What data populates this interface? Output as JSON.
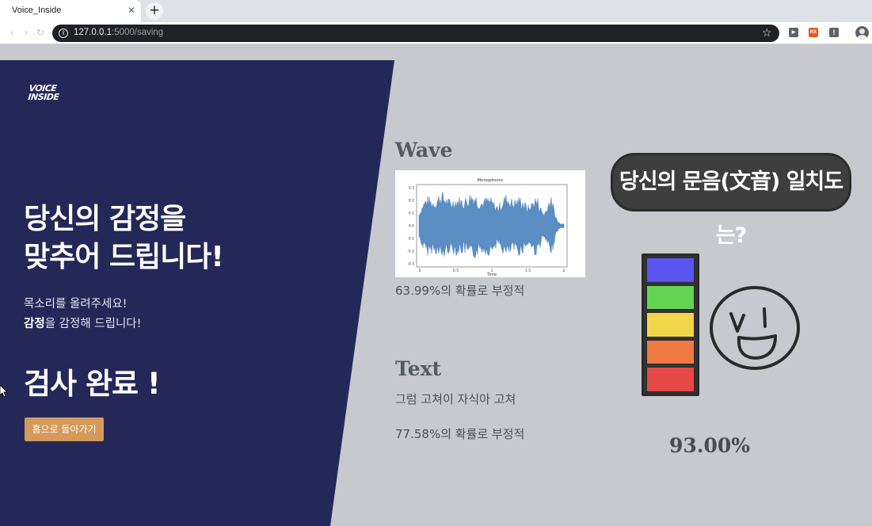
{
  "browser": {
    "tab_title": "Voice_Inside",
    "tab_close": "✕",
    "new_tab": "+",
    "url_host": "127.0.0.1",
    "url_rest": ":5000/saving",
    "icons": [
      "info-icon",
      "star-icon",
      "cast-icon",
      "rx-extension-icon",
      "exclamation-extension-icon",
      "profile-icon"
    ]
  },
  "logo": {
    "line1": "VOICE",
    "line2": "INSIDE"
  },
  "hero": {
    "title_line1": "당신의 감정을",
    "title_line2": "맞추어 드립니다!",
    "sub_line1": "목소리를 올려주세요!",
    "sub_line2_bold": "감정",
    "sub_line2_rest": "을 감정해 드립니다!",
    "done": "검사 완료 !",
    "home_button": "홈으로 돌아가기"
  },
  "wave": {
    "heading": "Wave",
    "plot_title": "Monophonic",
    "plot_xlabel": "Time",
    "plot_yticks": [
      "0.3",
      "0.2",
      "0.1",
      "0.0",
      "-0.1",
      "-0.2",
      "-0.3"
    ],
    "plot_xticks": [
      "0",
      "0.5",
      "1",
      "1.5",
      "2"
    ],
    "result": "63.99%의 확률로 부정적"
  },
  "text": {
    "heading": "Text",
    "transcript": "그럼 고쳐이 자식아 고쳐",
    "result": "77.58%의 확률로 부정적"
  },
  "pronunciation": {
    "speech_bubble": "당신의 문음(文音) 일치도는?",
    "score": "93.00%",
    "meter_colors": [
      "#5b55f0",
      "#62d452",
      "#f2d64a",
      "#ef7a44",
      "#e64848"
    ]
  },
  "colors": {
    "navy": "#232858",
    "background": "#c7c9ce",
    "button": "#d39a5a"
  }
}
